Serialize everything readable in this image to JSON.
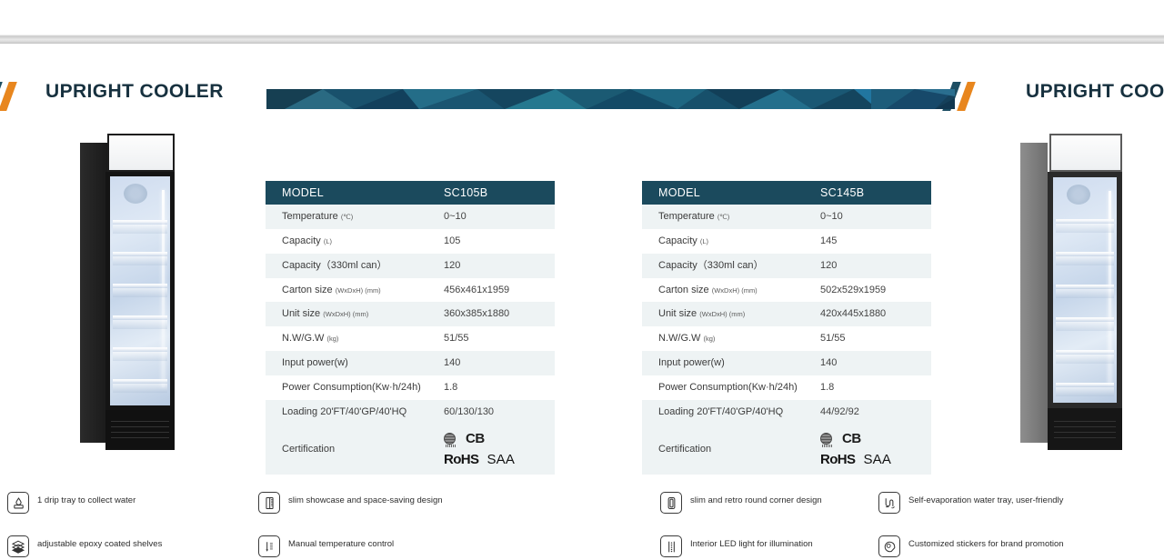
{
  "header": {
    "title_left": "UPRIGHT COOLER",
    "title_right": "UPRIGHT COOLER",
    "accent_teal": "#1d4e63",
    "accent_orange": "#e8861e",
    "banner_color": "#1d5066"
  },
  "tables": [
    {
      "id": "table-left",
      "header": {
        "label": "MODEL",
        "value": "SC105B"
      },
      "rows": [
        {
          "label": "Temperature",
          "sub": "(℃)",
          "value": "0~10"
        },
        {
          "label": "Capacity",
          "sub": "(L)",
          "value": "105"
        },
        {
          "label": "Capacity（330ml can）",
          "sub": "",
          "value": "120"
        },
        {
          "label": "Carton size",
          "sub": "(WxDxH) (mm)",
          "value": "456x461x1959"
        },
        {
          "label": "Unit size",
          "sub": "(WxDxH) (mm)",
          "value": "360x385x1880"
        },
        {
          "label": "N.W/G.W",
          "sub": "(kg)",
          "value": "51/55"
        },
        {
          "label": "Input power(w)",
          "sub": "",
          "value": "140"
        },
        {
          "label": "Power Consumption(Kw·h/24h)",
          "sub": "",
          "value": "1.8"
        },
        {
          "label": "Loading 20'FT/40'GP/40'HQ",
          "sub": "",
          "value": "60/130/130"
        }
      ],
      "certification": {
        "label": "Certification",
        "marks": [
          "globe-mark",
          "CB",
          "RoHS",
          "SAA"
        ]
      }
    },
    {
      "id": "table-right",
      "header": {
        "label": "MODEL",
        "value": "SC145B"
      },
      "rows": [
        {
          "label": "Temperature",
          "sub": "(℃)",
          "value": "0~10"
        },
        {
          "label": "Capacity",
          "sub": "(L)",
          "value": "145"
        },
        {
          "label": "Capacity（330ml can）",
          "sub": "",
          "value": "120"
        },
        {
          "label": "Carton size",
          "sub": "(WxDxH) (mm)",
          "value": "502x529x1959"
        },
        {
          "label": "Unit size",
          "sub": "(WxDxH) (mm)",
          "value": "420x445x1880"
        },
        {
          "label": "N.W/G.W",
          "sub": "(kg)",
          "value": "51/55"
        },
        {
          "label": "Input power(w)",
          "sub": "",
          "value": "140"
        },
        {
          "label": "Power Consumption(Kw·h/24h)",
          "sub": "",
          "value": "1.8"
        },
        {
          "label": "Loading 20'FT/40'GP/40'HQ",
          "sub": "",
          "value": "44/92/92"
        }
      ],
      "certification": {
        "label": "Certification",
        "marks": [
          "globe-mark",
          "CB",
          "RoHS",
          "SAA"
        ]
      }
    }
  ],
  "products": [
    {
      "name": "upright-cooler-sc105b",
      "cabinet_color": "#1a1a1a",
      "finish": "black"
    },
    {
      "name": "upright-cooler-sc145b",
      "cabinet_color": "#7b7b7b",
      "finish": "grey"
    }
  ],
  "features": [
    {
      "icon": "drip-tray-icon",
      "text": "1 drip tray to collect water"
    },
    {
      "icon": "stacked-shelves-icon",
      "text": "adjustable epoxy coated shelves"
    },
    {
      "icon": "slim-showcase-icon",
      "text": "slim showcase and space-saving design"
    },
    {
      "icon": "thermometer-icon",
      "text": "Manual temperature control"
    },
    {
      "icon": "round-corner-icon",
      "text": "slim and retro round corner design"
    },
    {
      "icon": "led-light-icon",
      "text": "Interior LED light for illumination"
    },
    {
      "icon": "water-tray-icon",
      "text": "Self-evaporation water tray, user-friendly"
    },
    {
      "icon": "sticker-icon",
      "text": "Customized stickers for brand promotion"
    }
  ]
}
